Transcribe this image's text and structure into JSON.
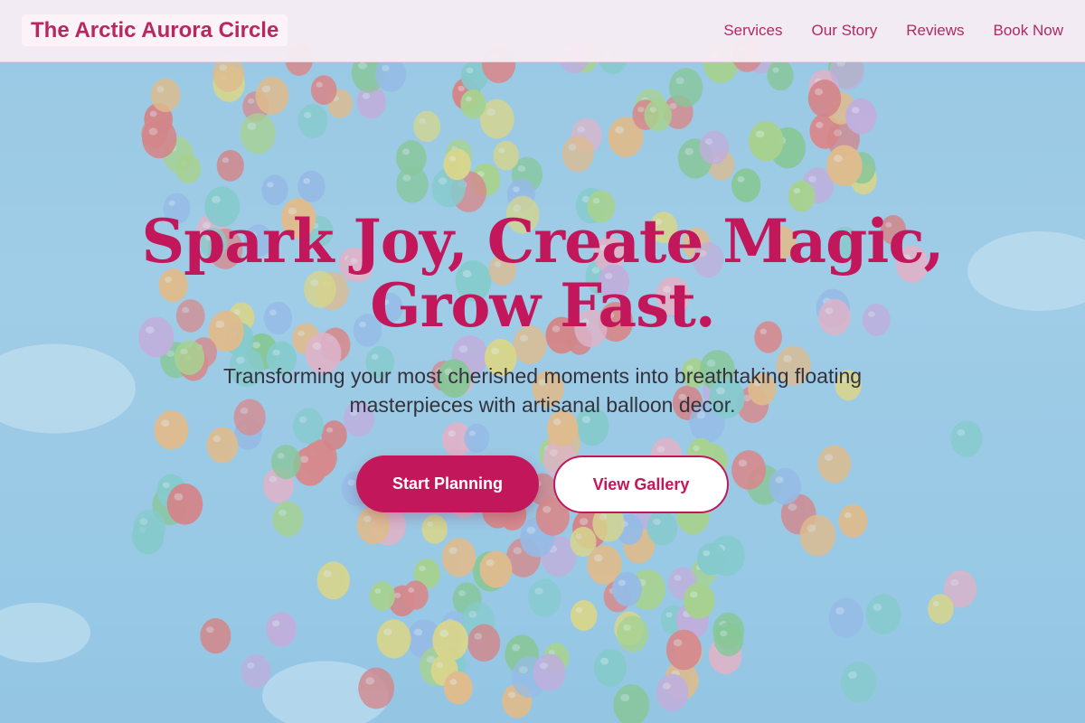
{
  "header": {
    "logo": "The Arctic Aurora Circle",
    "nav": [
      {
        "label": "Services"
      },
      {
        "label": "Our Story"
      },
      {
        "label": "Reviews"
      },
      {
        "label": "Book Now"
      }
    ]
  },
  "hero": {
    "headline_line1": "Spark Joy, Create Magic,",
    "headline_line2": "Grow Fast.",
    "subtext": "Transforming your most cherished moments into breathtaking floating masterpieces with artisanal balloon decor.",
    "primary_button": "Start Planning",
    "secondary_button": "View Gallery",
    "background_image": "balloons-in-blue-sky"
  },
  "colors": {
    "accent": "#c2185b",
    "header_bg": "#f7ecf4",
    "sky": "#93c6e2",
    "body_text": "#33323d"
  }
}
